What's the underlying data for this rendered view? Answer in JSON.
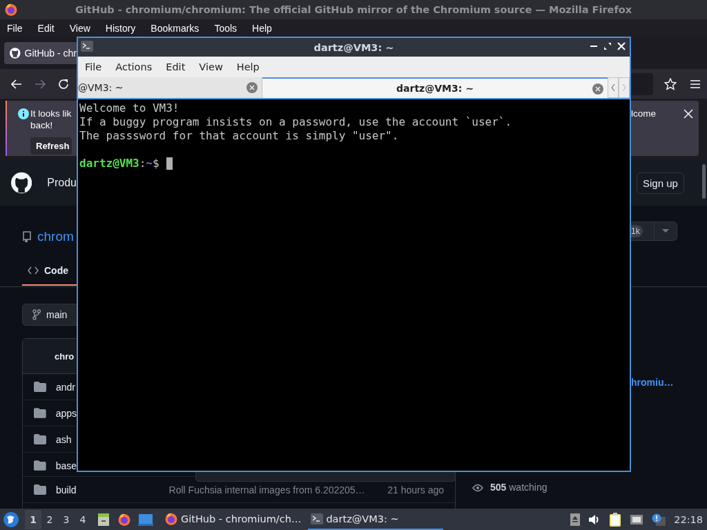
{
  "browser": {
    "title": "GitHub - chromium/chromium: The official GitHub mirror of the Chromium source — Mozilla Firefox",
    "menu": [
      "File",
      "Edit",
      "View",
      "History",
      "Bookmarks",
      "Tools",
      "Help"
    ],
    "tab": "GitHub - chr",
    "notification": {
      "lines": [
        "It looks lik",
        "back!"
      ],
      "button": "Refresh",
      "text_right": "lcome"
    },
    "github": {
      "nav": "Produ",
      "sign_up": "Sign up",
      "repo": "chrom",
      "count": "1k",
      "tab": "Code",
      "branch": "main",
      "table_header": "chro",
      "files": [
        {
          "name": "andr"
        },
        {
          "name": "apps"
        },
        {
          "name": "ash"
        },
        {
          "name": "base"
        },
        {
          "name": "build",
          "message": "Roll Fuchsia internal images from 6.202205…",
          "time": "21 hours ago"
        }
      ],
      "about_link": "hromiu…",
      "watching": {
        "count": "505",
        "label": "watching"
      }
    }
  },
  "terminal": {
    "title": "dartz@VM3: ~",
    "menu": [
      "File",
      "Actions",
      "Edit",
      "View",
      "Help"
    ],
    "tabs": [
      {
        "label": "@VM3: ~",
        "selected": false
      },
      {
        "label": "dartz@VM3: ~",
        "selected": true
      }
    ],
    "lines": [
      "Welcome to VM3!",
      "If a buggy program insists on a password, use the account `user`.",
      "The passsword for that account is simply \"user\"."
    ],
    "prompt": {
      "user_host": "dartz@VM3",
      "separator": ":",
      "path": "~",
      "symbol": "$"
    }
  },
  "taskbar": {
    "workspaces": [
      {
        "label": "1",
        "selected": true
      },
      {
        "label": "2",
        "selected": false
      },
      {
        "label": "3",
        "selected": false
      },
      {
        "label": "4",
        "selected": false
      }
    ],
    "tasks": [
      {
        "label": "GitHub - chromium/ch…",
        "kind": "browser",
        "selected": false
      },
      {
        "label": "dartz@VM3: ~",
        "kind": "terminal",
        "selected": true
      }
    ],
    "clock": "22:18"
  }
}
